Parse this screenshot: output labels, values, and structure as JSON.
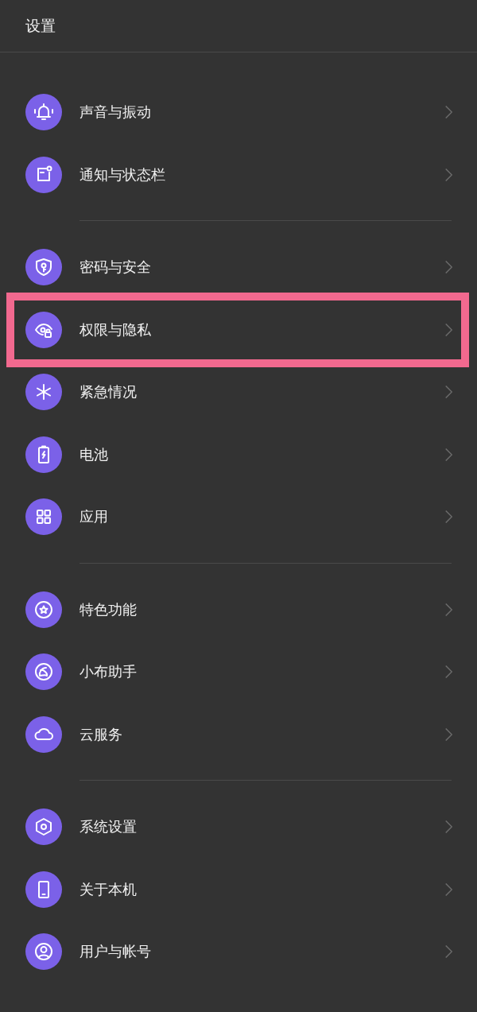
{
  "header": {
    "title": "设置"
  },
  "groups": [
    {
      "items": [
        {
          "label": "声音与振动",
          "highlighted": false
        },
        {
          "label": "通知与状态栏",
          "highlighted": false
        }
      ]
    },
    {
      "items": [
        {
          "label": "密码与安全",
          "highlighted": false
        },
        {
          "label": "权限与隐私",
          "highlighted": true
        },
        {
          "label": "紧急情况",
          "highlighted": false
        },
        {
          "label": "电池",
          "highlighted": false
        },
        {
          "label": "应用",
          "highlighted": false
        }
      ]
    },
    {
      "items": [
        {
          "label": "特色功能",
          "highlighted": false
        },
        {
          "label": "小布助手",
          "highlighted": false
        },
        {
          "label": "云服务",
          "highlighted": false
        }
      ]
    },
    {
      "items": [
        {
          "label": "系统设置",
          "highlighted": false
        },
        {
          "label": "关于本机",
          "highlighted": false
        },
        {
          "label": "用户与帐号",
          "highlighted": false
        }
      ]
    }
  ]
}
